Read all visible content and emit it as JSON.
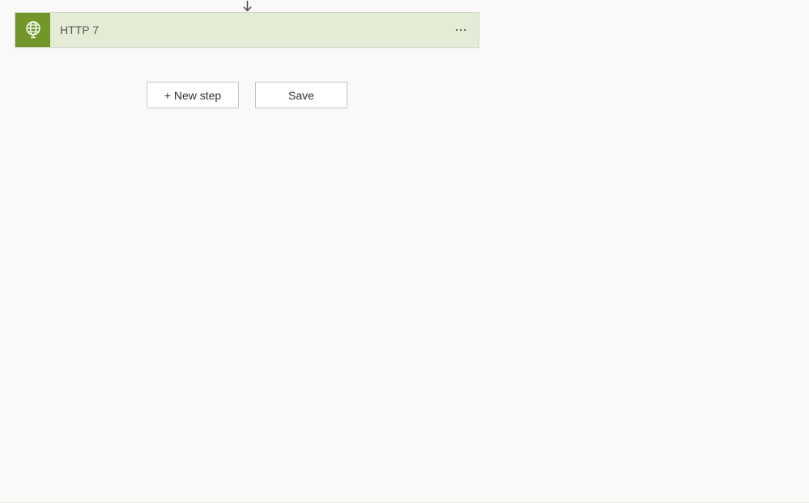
{
  "colors": {
    "action_accent": "#709727",
    "action_bg": "#e4ecd6"
  },
  "action": {
    "title": "HTTP 7",
    "icon": "globe-icon"
  },
  "buttons": {
    "new_step_label": "+ New step",
    "save_label": "Save"
  }
}
